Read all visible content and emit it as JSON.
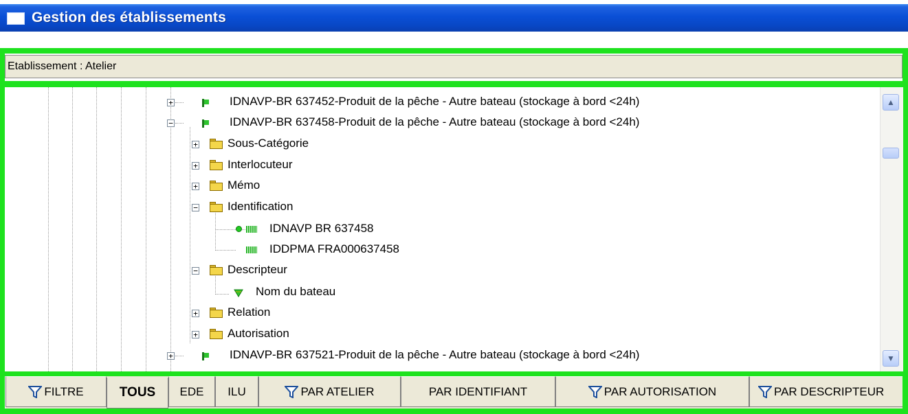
{
  "window": {
    "title": "Gestion des établissements"
  },
  "etablissement": {
    "label": "Etablissement : Atelier"
  },
  "tree": {
    "nodes": [
      {
        "text": "IDNAVP-BR 637452-Produit de la pêche - Autre bateau (stockage à bord <24h)",
        "expander": "+"
      },
      {
        "text": "IDNAVP-BR 637458-Produit de la pêche - Autre bateau (stockage à bord <24h)",
        "expander": "−"
      },
      {
        "text": "Sous-Catégorie",
        "expander": "+"
      },
      {
        "text": "Interlocuteur",
        "expander": "+"
      },
      {
        "text": "Mémo",
        "expander": "+"
      },
      {
        "text": "Identification",
        "expander": "−"
      },
      {
        "text": "IDNAVP BR 637458"
      },
      {
        "text": "IDDPMA FRA000637458"
      },
      {
        "text": "Descripteur",
        "expander": "−"
      },
      {
        "text": "Nom du bateau"
      },
      {
        "text": "Relation",
        "expander": "+"
      },
      {
        "text": "Autorisation",
        "expander": "+"
      },
      {
        "text": "IDNAVP-BR 637521-Produit de la pêche - Autre bateau (stockage à bord <24h)",
        "expander": "+"
      }
    ]
  },
  "tabs": [
    {
      "label": "FILTRE",
      "icon": "funnel-icon"
    },
    {
      "label": "TOUS",
      "active": true
    },
    {
      "label": "EDE"
    },
    {
      "label": "ILU"
    },
    {
      "label": "PAR ATELIER",
      "icon": "funnel-icon"
    },
    {
      "label": "PAR IDENTIFIANT"
    },
    {
      "label": "PAR AUTORISATION",
      "icon": "funnel-icon"
    },
    {
      "label": "PAR DESCRIPTEUR",
      "icon": "funnel-icon"
    }
  ],
  "colors": {
    "titlebar": "#0a4fd6",
    "frame_green": "#1ee21e",
    "panel": "#ece9d8"
  }
}
